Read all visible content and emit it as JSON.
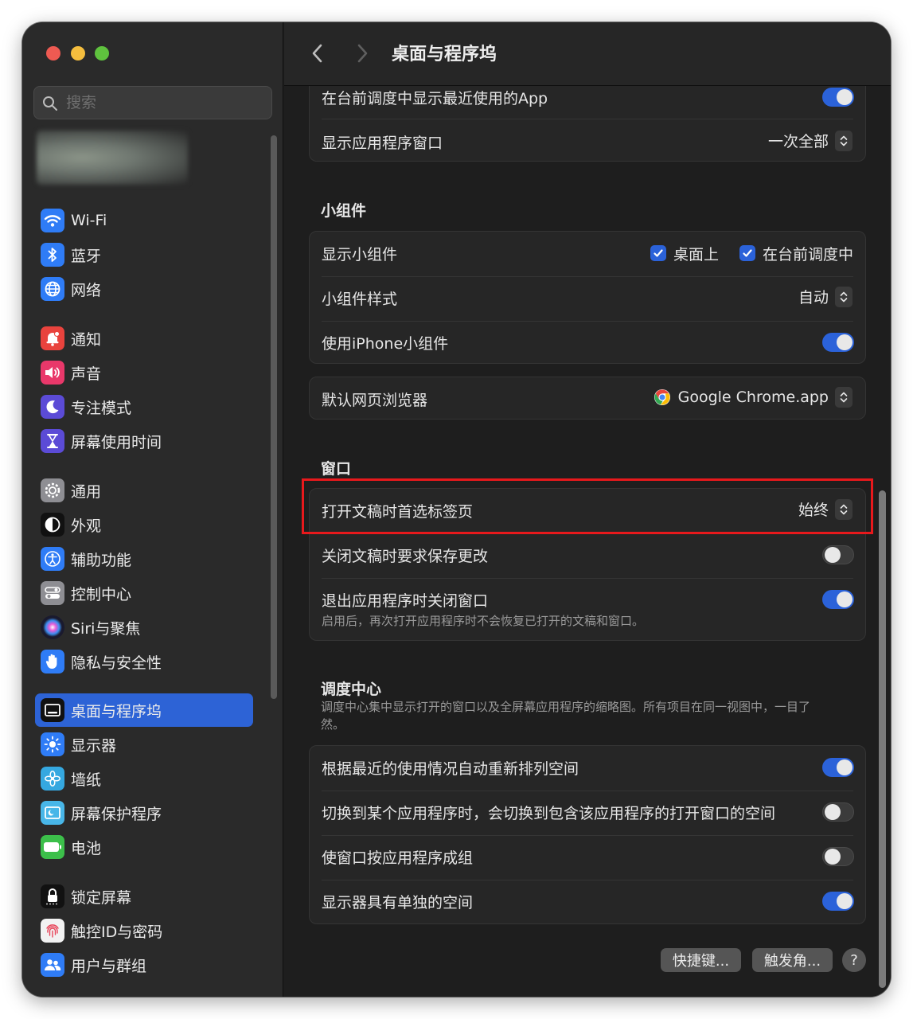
{
  "window": {
    "title": "桌面与程序坞"
  },
  "search": {
    "placeholder": "搜索"
  },
  "sidebar": {
    "items": [
      {
        "label": "Wi-Fi",
        "icon": "wifi-icon",
        "color": "#2f7cf6"
      },
      {
        "label": "蓝牙",
        "icon": "bluetooth-icon",
        "color": "#2f7cf6"
      },
      {
        "label": "网络",
        "icon": "globe-icon",
        "color": "#2f7cf6"
      },
      {
        "label": "通知",
        "icon": "bell-icon",
        "color": "#e9433d"
      },
      {
        "label": "声音",
        "icon": "speaker-icon",
        "color": "#e9386a"
      },
      {
        "label": "专注模式",
        "icon": "moon-icon",
        "color": "#5b4bd6"
      },
      {
        "label": "屏幕使用时间",
        "icon": "hourglass-icon",
        "color": "#5b4bd6"
      },
      {
        "label": "通用",
        "icon": "gear-icon",
        "color": "#8e8e93"
      },
      {
        "label": "外观",
        "icon": "appearance-icon",
        "color": "#111111"
      },
      {
        "label": "辅助功能",
        "icon": "accessibility-icon",
        "color": "#2f7cf6"
      },
      {
        "label": "控制中心",
        "icon": "control-center-icon",
        "color": "#8e8e93"
      },
      {
        "label": "Siri与聚焦",
        "icon": "siri-icon",
        "color": "#1a1a2e"
      },
      {
        "label": "隐私与安全性",
        "icon": "hand-icon",
        "color": "#2f7cf6"
      },
      {
        "label": "桌面与程序坞",
        "icon": "dock-icon",
        "color": "#111111",
        "active": true
      },
      {
        "label": "显示器",
        "icon": "sun-icon",
        "color": "#2f7cf6"
      },
      {
        "label": "墙纸",
        "icon": "flower-icon",
        "color": "#35a8e0"
      },
      {
        "label": "屏幕保护程序",
        "icon": "screensaver-icon",
        "color": "#48b6e8"
      },
      {
        "label": "电池",
        "icon": "battery-icon",
        "color": "#3cbf4a"
      },
      {
        "label": "锁定屏幕",
        "icon": "lock-icon",
        "color": "#111111"
      },
      {
        "label": "触控ID与密码",
        "icon": "fingerprint-icon",
        "color": "#f2f2f2"
      },
      {
        "label": "用户与群组",
        "icon": "users-icon",
        "color": "#2f7cf6"
      }
    ]
  },
  "stage_group": {
    "recent_apps_label": "在台前调度中显示最近使用的App",
    "recent_apps_on": true,
    "show_windows_label": "显示应用程序窗口",
    "show_windows_value": "一次全部"
  },
  "widgets": {
    "title": "小组件",
    "show_label": "显示小组件",
    "desktop_label": "桌面上",
    "stage_label": "在台前调度中",
    "style_label": "小组件样式",
    "style_value": "自动",
    "iphone_label": "使用iPhone小组件",
    "iphone_on": true
  },
  "browser": {
    "label": "默认网页浏览器",
    "value": "Google Chrome.app"
  },
  "windows": {
    "title": "窗口",
    "tabs_label": "打开文稿时首选标签页",
    "tabs_value": "始终",
    "ask_save_label": "关闭文稿时要求保存更改",
    "ask_save_on": false,
    "close_windows_label": "退出应用程序时关闭窗口",
    "close_windows_on": true,
    "close_windows_desc": "启用后，再次打开应用程序时不会恢复已打开的文稿和窗口。"
  },
  "mission_control": {
    "title": "调度中心",
    "desc": "调度中心集中显示打开的窗口以及全屏幕应用程序的缩略图。所有项目在同一视图中，一目了然。",
    "rearrange_label": "根据最近的使用情况自动重新排列空间",
    "rearrange_on": true,
    "switch_label": "切换到某个应用程序时，会切换到包含该应用程序的打开窗口的空间",
    "switch_on": false,
    "group_label": "使窗口按应用程序成组",
    "group_on": false,
    "separate_label": "显示器具有单独的空间",
    "separate_on": true
  },
  "footer": {
    "shortcuts_label": "快捷键...",
    "hot_corners_label": "触发角...",
    "help_label": "?"
  },
  "colors": {
    "accent": "#2b62d9",
    "highlight": "#e8191c"
  }
}
